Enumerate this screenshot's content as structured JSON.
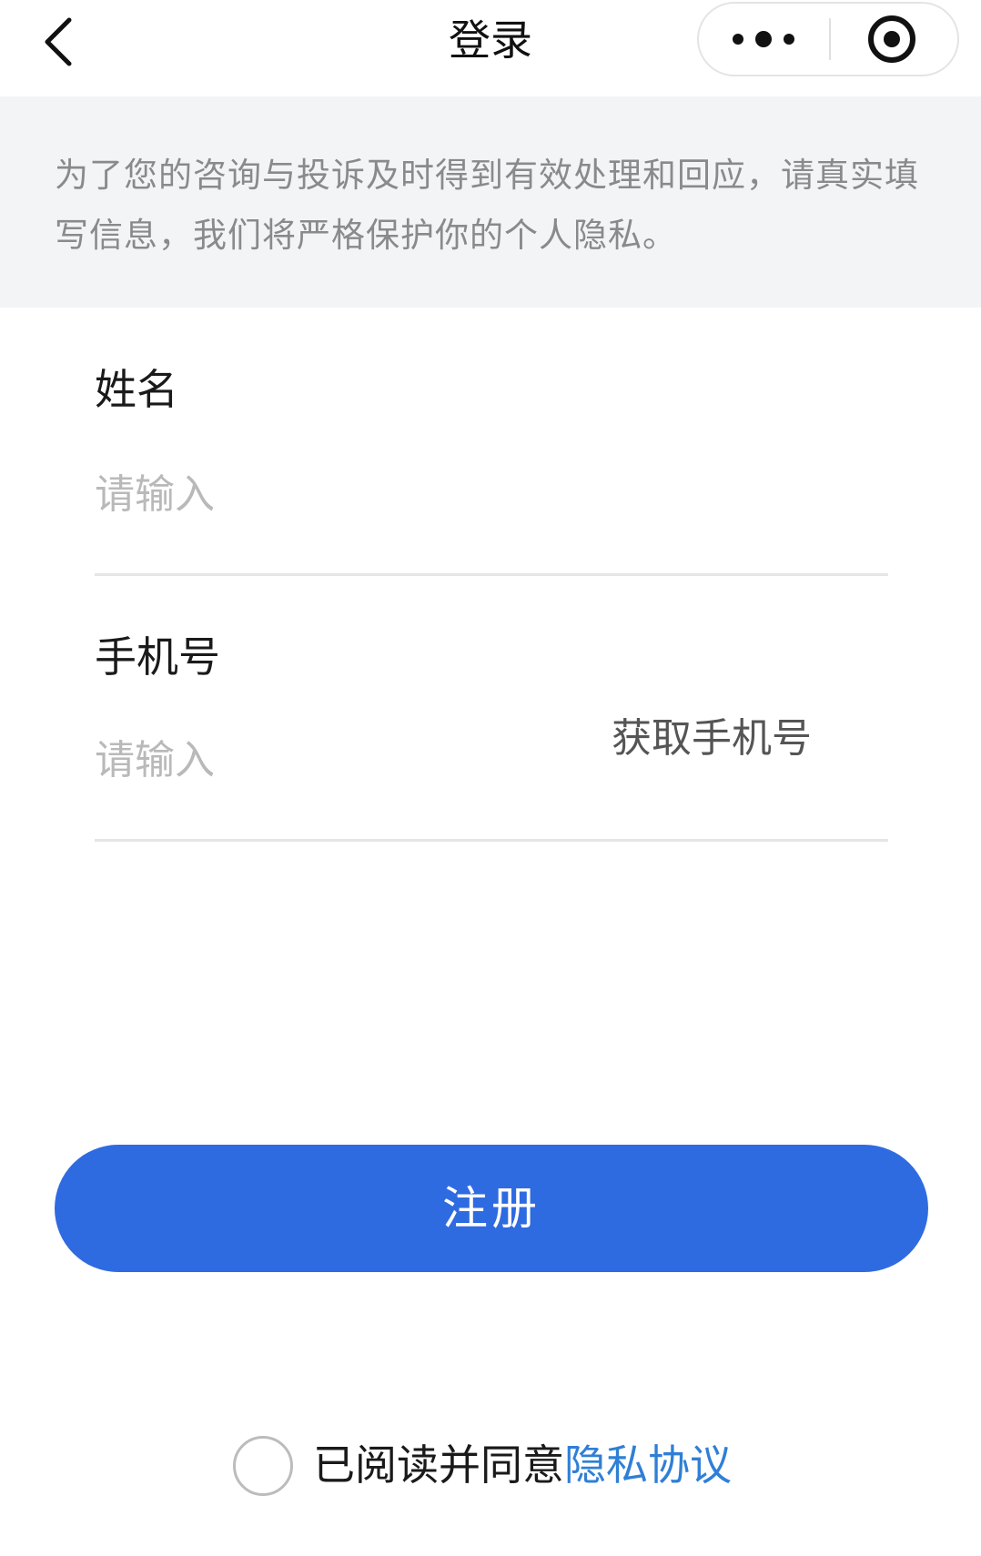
{
  "nav": {
    "title": "登录",
    "icons": [
      "chevron-left-icon",
      "more-dots-icon",
      "target-close-icon"
    ]
  },
  "notice": {
    "text": "为了您的咨询与投诉及时得到有效处理和回应，请真实填写信息，我们将严格保护你的个人隐私。"
  },
  "form": {
    "name": {
      "label": "姓名",
      "value": "",
      "placeholder": "请输入"
    },
    "phone": {
      "label": "手机号",
      "value": "",
      "placeholder": "请输入",
      "get_phone_label": "获取手机号"
    }
  },
  "register_button": {
    "label": "注册",
    "color": "#2f6be0"
  },
  "agreement": {
    "checked": false,
    "text": "已阅读并同意",
    "link_text": "隐私协议",
    "link_color": "#2f7fd6"
  }
}
